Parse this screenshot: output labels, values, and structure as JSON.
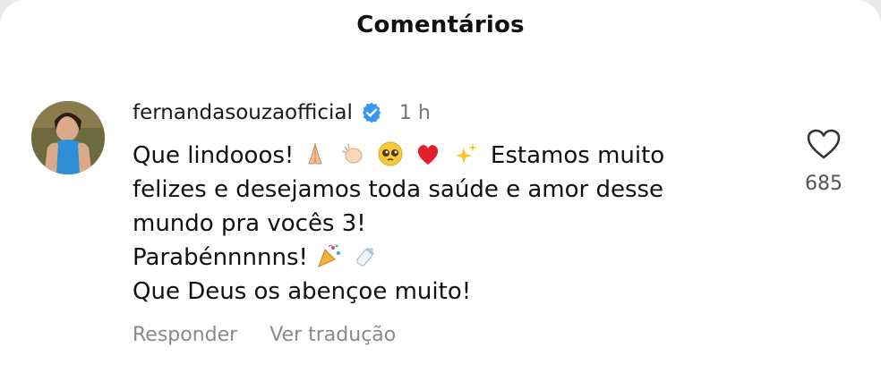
{
  "header": {
    "title": "Comentários"
  },
  "comment": {
    "username": "fernandasouzaofficial",
    "verified_icon": "verified-badge-icon",
    "time_ago": "1 h",
    "lines": [
      "Que lindooos!",
      "Estamos muito",
      "felizes e desejamos toda saúde e amor desse",
      "mundo pra vocês 3!",
      "Parabénnnnns!",
      "Que Deus os abençoe muito!"
    ],
    "emojis_line1": [
      "folded-hands-icon",
      "clapping-hands-icon",
      "pleading-face-icon",
      "red-heart-icon",
      "sparkles-icon"
    ],
    "emojis_line5": [
      "party-popper-icon",
      "baby-bottle-icon"
    ],
    "like_count": "685"
  },
  "actions": {
    "reply": "Responder",
    "translate": "Ver tradução"
  },
  "colors": {
    "background": "#ffffff",
    "verified": "#3897f0",
    "muted": "#8a8a8a"
  }
}
